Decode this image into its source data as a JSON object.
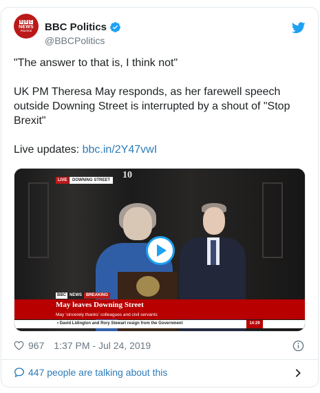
{
  "header": {
    "avatar_text_news": "NEWS",
    "avatar_text_politics": "POLITICS",
    "avatar_text_bbc": [
      "B",
      "B",
      "C"
    ],
    "display_name": "BBC Politics",
    "handle": "@BBCPolitics"
  },
  "tweet": {
    "line1": "\"The answer to that is, I think not\"",
    "line2": "UK PM Theresa May responds, as her farewell speech outside Downing Street is interrupted by a shout of \"Stop Brexit\"",
    "live_label": "Live updates: ",
    "link_text": "bbc.in/2Y47vwI"
  },
  "media": {
    "door_number": "10",
    "live_tag": "LIVE",
    "location_tag": "DOWNING STREET",
    "lower_third": {
      "bbc": "BBC",
      "news": "NEWS",
      "breaking": "BREAKING",
      "headline": "May leaves Downing Street",
      "subline": "May 'sincerely thanks' colleagues and civil servants",
      "ticker": "• David Lidington and Rory Stewart resign from the Government",
      "clock": "14:29"
    }
  },
  "meta": {
    "likes": "967",
    "timestamp": "1:37 PM - Jul 24, 2019"
  },
  "footer": {
    "talking": "447 people are talking about this"
  },
  "colors": {
    "accent": "#1da1f2",
    "link": "#2b7bb9",
    "bbc_red": "#bb1919"
  }
}
